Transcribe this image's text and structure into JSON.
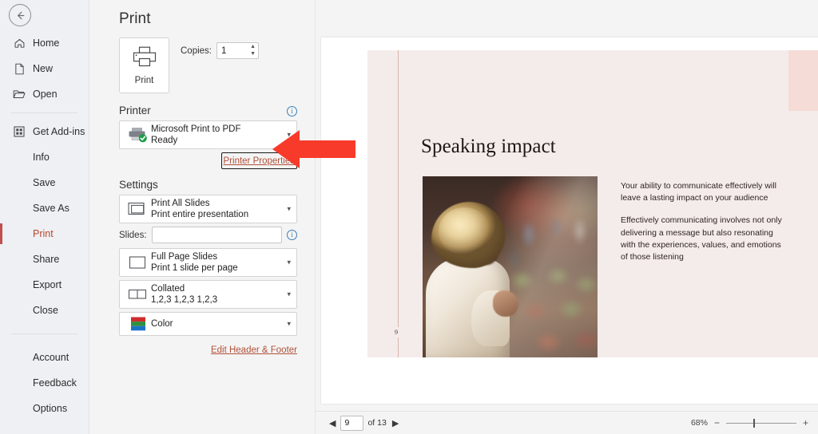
{
  "sidebar": {
    "back_icon": "back-arrow-icon",
    "items": [
      {
        "label": "Home",
        "icon": "home-icon",
        "selected": false
      },
      {
        "label": "New",
        "icon": "new-doc-icon",
        "selected": false
      },
      {
        "label": "Open",
        "icon": "folder-icon",
        "selected": false
      },
      {
        "label": "Get Add-ins",
        "icon": "addins-icon",
        "selected": false
      },
      {
        "label": "Info",
        "icon": "",
        "selected": false
      },
      {
        "label": "Save",
        "icon": "",
        "selected": false
      },
      {
        "label": "Save As",
        "icon": "",
        "selected": false
      },
      {
        "label": "Print",
        "icon": "",
        "selected": true
      },
      {
        "label": "Share",
        "icon": "",
        "selected": false
      },
      {
        "label": "Export",
        "icon": "",
        "selected": false
      },
      {
        "label": "Close",
        "icon": "",
        "selected": false
      },
      {
        "label": "Account",
        "icon": "",
        "selected": false
      },
      {
        "label": "Feedback",
        "icon": "",
        "selected": false
      },
      {
        "label": "Options",
        "icon": "",
        "selected": false
      }
    ],
    "accent_color": "#c0504d",
    "selected_text_color": "#b7472a",
    "background": "#eef0f4"
  },
  "print_pane": {
    "title": "Print",
    "print_button_label": "Print",
    "print_button_icon": "printer-icon",
    "copies_label": "Copies:",
    "copies_value": "1",
    "printer_section": {
      "heading": "Printer",
      "info_icon": "info-icon",
      "name": "Microsoft Print to PDF",
      "status": "Ready",
      "icon": "printer-ready-icon",
      "chevron": "chevron-down-icon",
      "properties_link": "Printer Properties",
      "properties_link_focused": true
    },
    "settings_section": {
      "heading": "Settings",
      "range": {
        "primary": "Print All Slides",
        "secondary": "Print entire presentation",
        "icon": "all-slides-icon"
      },
      "slides_label": "Slides:",
      "slides_value": "",
      "slides_info_icon": "info-icon",
      "layout": {
        "primary": "Full Page Slides",
        "secondary": "Print 1 slide per page",
        "icon": "full-page-icon"
      },
      "collation": {
        "primary": "Collated",
        "secondary": "1,2,3   1,2,3   1,2,3",
        "icon": "collated-icon"
      },
      "color": {
        "primary": "Color",
        "icon": "color-swatch-icon"
      },
      "header_footer_link": "Edit Header & Footer"
    }
  },
  "preview": {
    "slide": {
      "title": "Speaking impact",
      "page_number": "9",
      "paragraphs": [
        "Your ability to communicate effectively will leave a lasting impact on your audience",
        "Effectively communicating involves not only delivering a message but also resonating with the experiences, values, and emotions of those listening"
      ],
      "image_alt": "woman-speaking-to-audience-photo",
      "background_color": "#f4eceb",
      "accent_block_color": "#f6dcd6",
      "rule_color": "#d9b4ab"
    }
  },
  "status_bar": {
    "prev_icon": "previous-page-icon",
    "next_icon": "next-page-icon",
    "current_page": "9",
    "of_label": "of 13",
    "total_pages": "13",
    "zoom_level": "68%",
    "zoom_out_icon": "zoom-out-icon",
    "zoom_in_icon": "zoom-in-icon"
  },
  "annotation": {
    "arrow": "red-left-arrow",
    "arrow_color": "#f83a2b",
    "points_to": "Printer Properties"
  }
}
